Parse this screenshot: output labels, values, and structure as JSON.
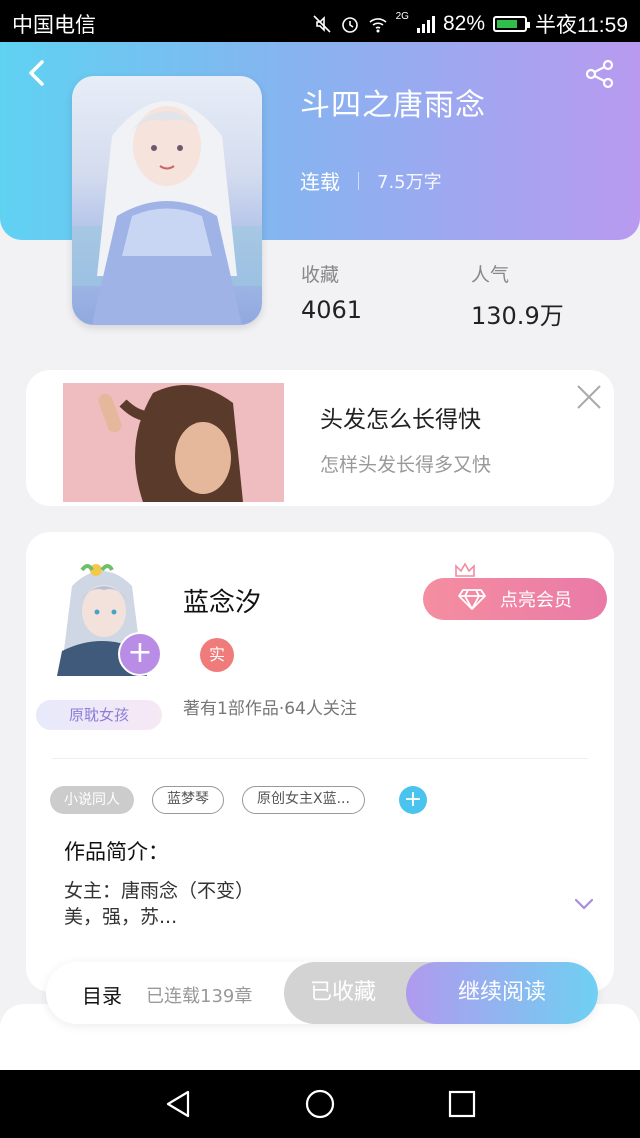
{
  "statusbar": {
    "carrier": "中国电信",
    "battery": "82%",
    "time": "半夜11:59",
    "network": "2G"
  },
  "book": {
    "title": "斗四之唐雨念",
    "status": "连载",
    "words": "7.5万字",
    "favorites_label": "收藏",
    "favorites_value": "4061",
    "popularity_label": "人气",
    "popularity_value": "130.9万"
  },
  "ad": {
    "title": "头发怎么长得快",
    "subtitle": "怎样头发长得多又快"
  },
  "author": {
    "name": "蓝念汐",
    "badge": "实",
    "tag": "原耽女孩",
    "stats": "著有1部作品·64人关注",
    "vip_label": "点亮会员",
    "follow_symbol": "+"
  },
  "tags": [
    "小说同人",
    "蓝梦琴",
    "原创女主X蓝..."
  ],
  "intro": {
    "label": "作品简介：",
    "line1": "女主：唐雨念（不变）",
    "line2": "美，强，苏..."
  },
  "actions": {
    "catalog": "目录",
    "chapters": "已连载139章",
    "collected": "已收藏",
    "continue": "继续阅读"
  },
  "colors": {
    "accent_blue": "#5fd2f2",
    "accent_purple": "#b99af0",
    "vip_pink": "#f58ea0"
  }
}
